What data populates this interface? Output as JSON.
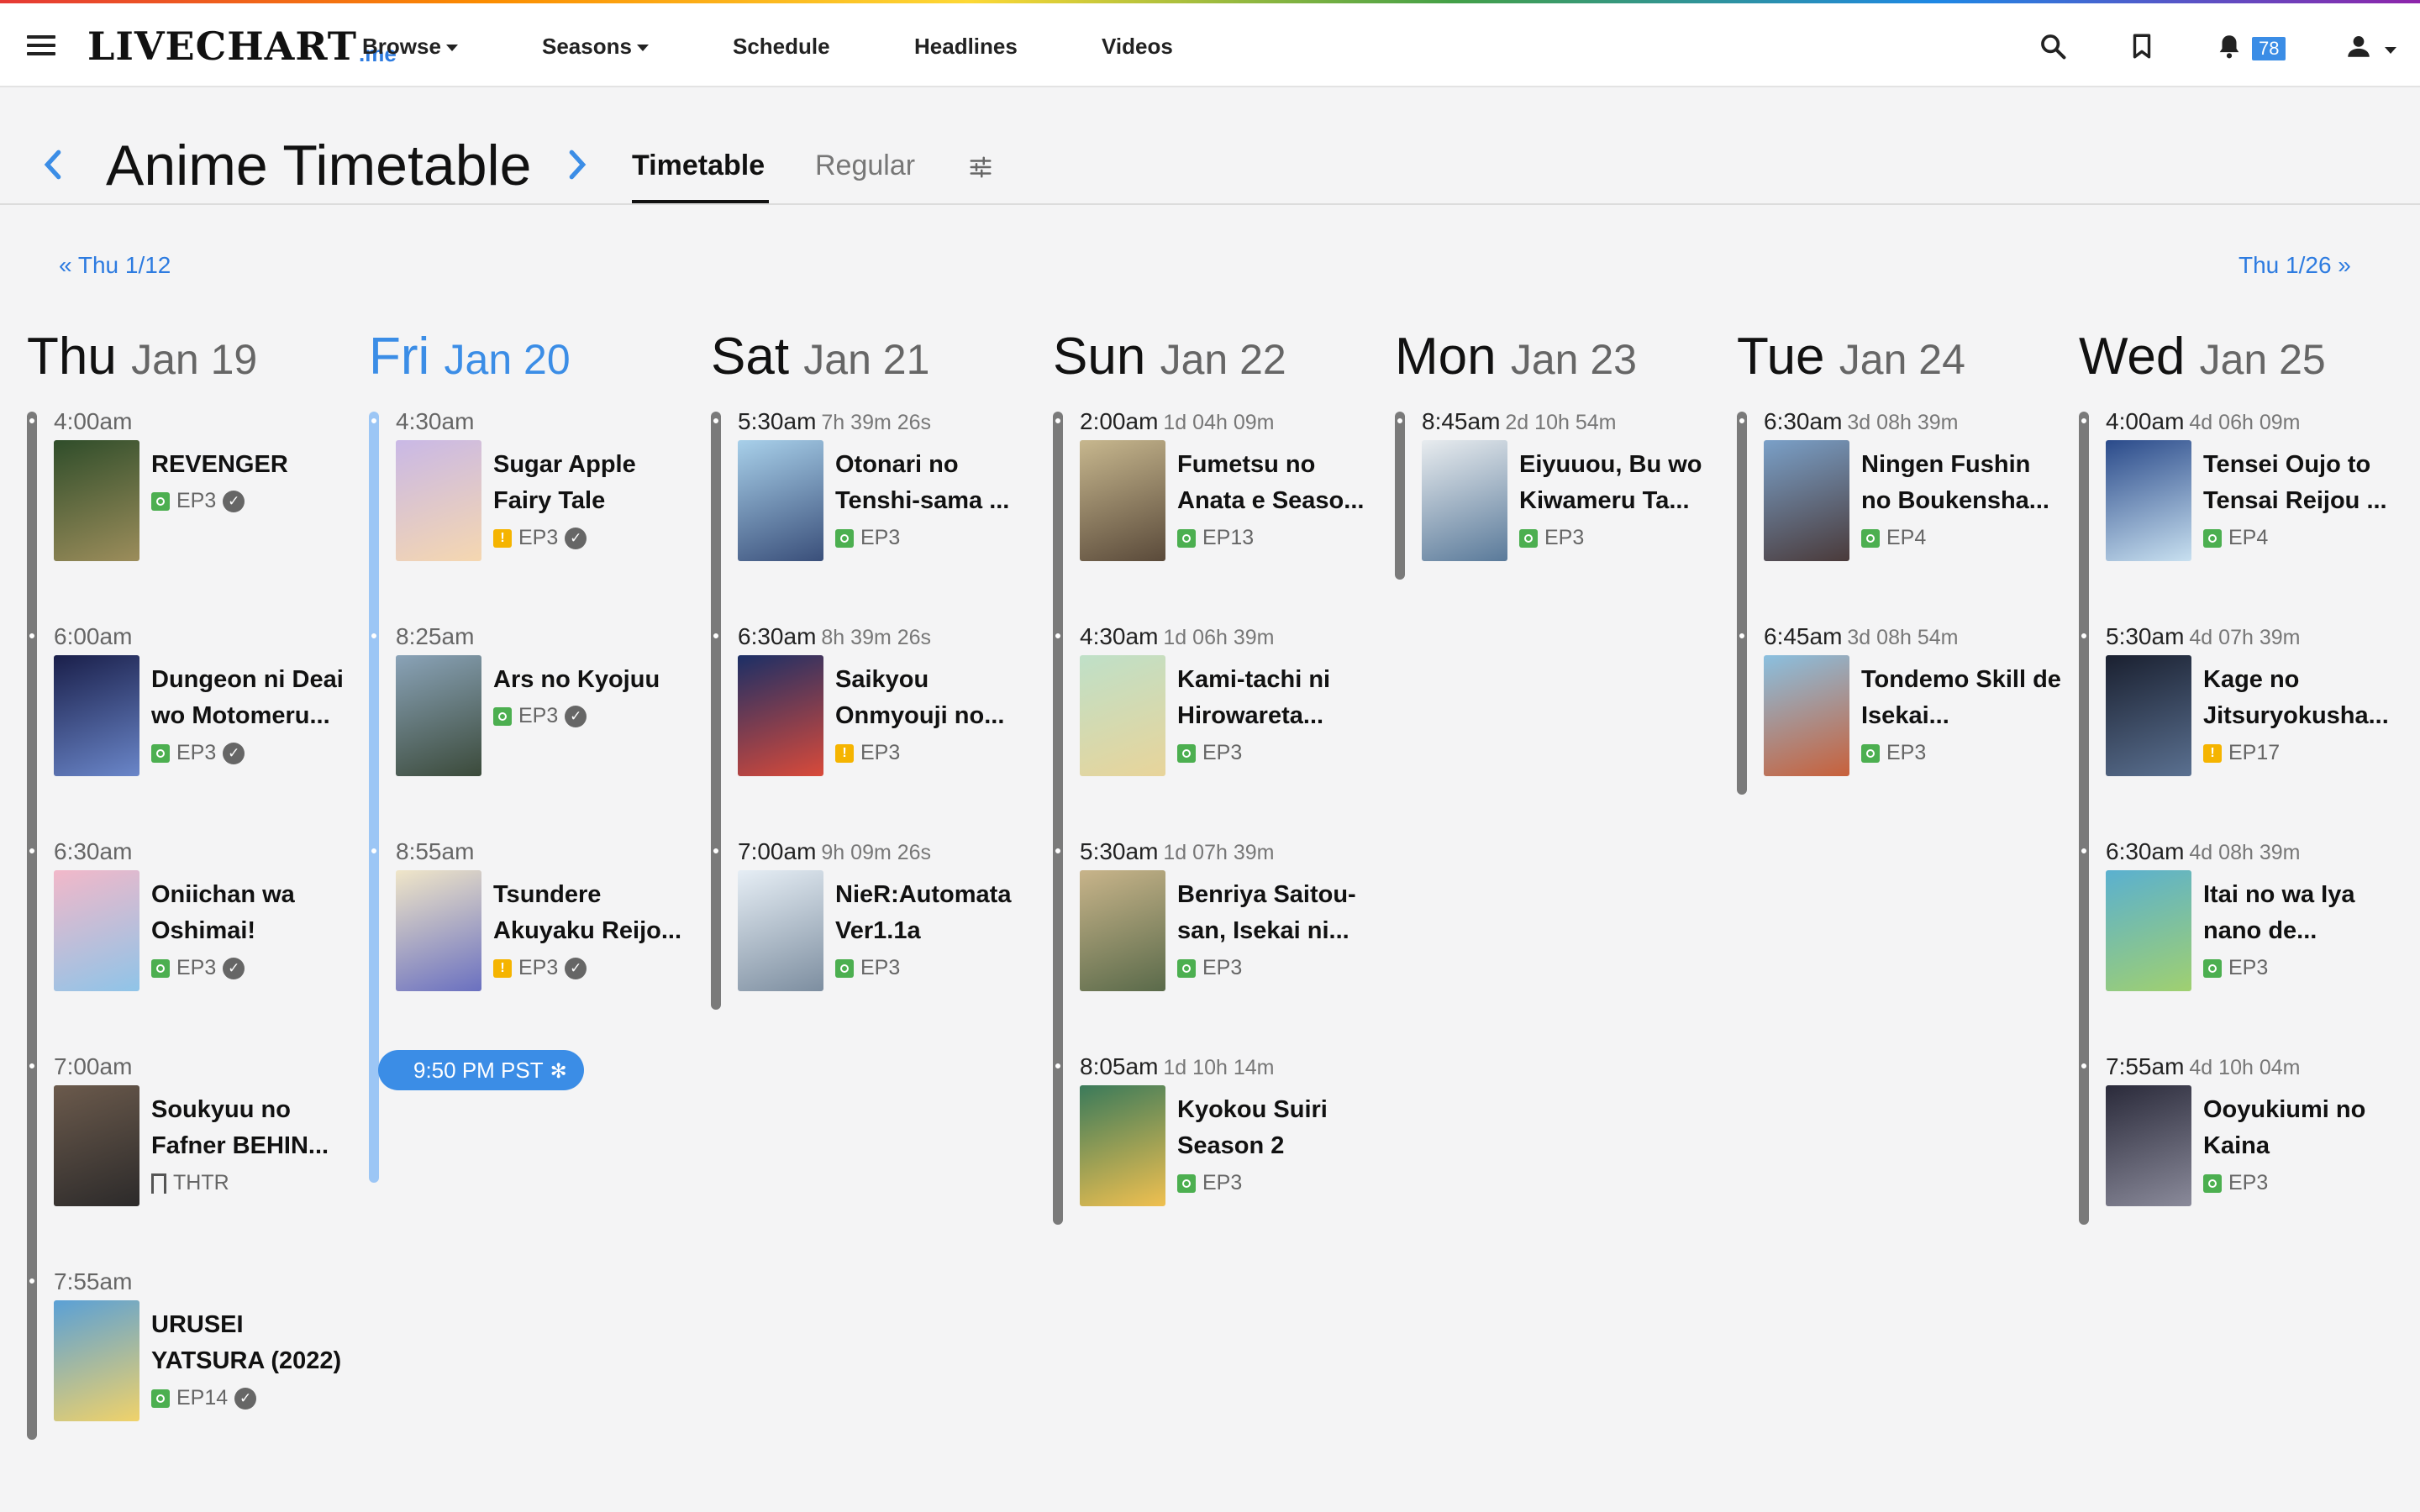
{
  "app": {
    "logo_main": "LIVECHART",
    "logo_suffix": ".me",
    "nav": [
      {
        "label": "Browse",
        "has_caret": true
      },
      {
        "label": "Seasons",
        "has_caret": true
      },
      {
        "label": "Schedule",
        "has_caret": false
      },
      {
        "label": "Headlines",
        "has_caret": false
      },
      {
        "label": "Videos",
        "has_caret": false
      }
    ],
    "notification_count": "78",
    "icons": [
      "menu-icon",
      "search-icon",
      "bookmark-icon",
      "bell-icon",
      "user-icon"
    ]
  },
  "header": {
    "title": "Anime Timetable",
    "tabs": [
      {
        "label": "Timetable",
        "active": true
      },
      {
        "label": "Regular",
        "active": false
      }
    ]
  },
  "week_nav": {
    "prev": "« Thu 1/12",
    "next": "Thu 1/26 »"
  },
  "current_time": "9:50 PM PST",
  "days": [
    {
      "name": "Thu",
      "date": "Jan 19",
      "today": false,
      "entries": [
        {
          "time": "4:00am",
          "countdown": "",
          "title": "REVENGER",
          "status": "watching",
          "episode": "EP3",
          "checked": true,
          "poster": [
            "#2f4d2a",
            "#9c8d5b"
          ]
        },
        {
          "time": "6:00am",
          "countdown": "",
          "title": "Dungeon ni Deai wo Motomeru...",
          "status": "watching",
          "episode": "EP3",
          "checked": true,
          "poster": [
            "#1a1f4a",
            "#6a86c9"
          ]
        },
        {
          "time": "6:30am",
          "countdown": "",
          "title": "Oniichan wa Oshimai!",
          "status": "watching",
          "episode": "EP3",
          "checked": true,
          "poster": [
            "#f2b8c9",
            "#8fc4e8"
          ]
        },
        {
          "time": "7:00am",
          "countdown": "",
          "title": "Soukyuu no Fafner BEHIN...",
          "status": "planned",
          "episode": "THTR",
          "checked": false,
          "poster": [
            "#6b5a4c",
            "#2c2a2a"
          ]
        },
        {
          "time": "7:55am",
          "countdown": "",
          "title": "URUSEI YATSURA (2022)",
          "status": "watching",
          "episode": "EP14",
          "checked": true,
          "poster": [
            "#5aa0d6",
            "#f0d26a"
          ]
        }
      ]
    },
    {
      "name": "Fri",
      "date": "Jan 20",
      "today": true,
      "entries": [
        {
          "time": "4:30am",
          "countdown": "",
          "title": "Sugar Apple Fairy Tale",
          "status": "paused",
          "episode": "EP3",
          "checked": true,
          "poster": [
            "#c9b8e6",
            "#f5d7b0"
          ]
        },
        {
          "time": "8:25am",
          "countdown": "",
          "title": "Ars no Kyojuu",
          "status": "watching",
          "episode": "EP3",
          "checked": true,
          "poster": [
            "#8aa3b8",
            "#3b4a3a"
          ]
        },
        {
          "time": "8:55am",
          "countdown": "",
          "title": "Tsundere Akuyaku Reijo...",
          "status": "paused",
          "episode": "EP3",
          "checked": true,
          "poster": [
            "#f0e6c8",
            "#6a70c0"
          ]
        }
      ]
    },
    {
      "name": "Sat",
      "date": "Jan 21",
      "today": false,
      "entries": [
        {
          "time": "5:30am",
          "countdown": "7h 39m 26s",
          "title": "Otonari no Tenshi-sama ...",
          "status": "watching",
          "episode": "EP3",
          "checked": false,
          "poster": [
            "#a8d0ea",
            "#3a4f7a"
          ]
        },
        {
          "time": "6:30am",
          "countdown": "8h 39m 26s",
          "title": "Saikyou Onmyouji no...",
          "status": "paused",
          "episode": "EP3",
          "checked": false,
          "poster": [
            "#1b2f66",
            "#d94a3a"
          ]
        },
        {
          "time": "7:00am",
          "countdown": "9h 09m 26s",
          "title": "NieR:Automata Ver1.1a",
          "status": "watching",
          "episode": "EP3",
          "checked": false,
          "poster": [
            "#e6eef5",
            "#7d8ea0"
          ]
        }
      ]
    },
    {
      "name": "Sun",
      "date": "Jan 22",
      "today": false,
      "entries": [
        {
          "time": "2:00am",
          "countdown": "1d 04h 09m",
          "title": "Fumetsu no Anata e Seaso...",
          "status": "watching",
          "episode": "EP13",
          "checked": false,
          "poster": [
            "#c7b78e",
            "#5a4a3a"
          ]
        },
        {
          "time": "4:30am",
          "countdown": "1d 06h 39m",
          "title": "Kami-tachi ni Hirowareta...",
          "status": "watching",
          "episode": "EP3",
          "checked": false,
          "poster": [
            "#bfe0c8",
            "#e8d49a"
          ]
        },
        {
          "time": "5:30am",
          "countdown": "1d 07h 39m",
          "title": "Benriya Saitou-san, Isekai ni...",
          "status": "watching",
          "episode": "EP3",
          "checked": false,
          "poster": [
            "#c8b48a",
            "#5a6a4a"
          ]
        },
        {
          "time": "8:05am",
          "countdown": "1d 10h 14m",
          "title": "Kyokou Suiri Season 2",
          "status": "watching",
          "episode": "EP3",
          "checked": false,
          "poster": [
            "#3a7a5a",
            "#f0c050"
          ]
        }
      ]
    },
    {
      "name": "Mon",
      "date": "Jan 23",
      "today": false,
      "entries": [
        {
          "time": "8:45am",
          "countdown": "2d 10h 54m",
          "title": "Eiyuuou, Bu wo Kiwameru Ta...",
          "status": "watching",
          "episode": "EP3",
          "checked": false,
          "poster": [
            "#e8ecef",
            "#5a7a9a"
          ]
        }
      ]
    },
    {
      "name": "Tue",
      "date": "Jan 24",
      "today": false,
      "entries": [
        {
          "time": "6:30am",
          "countdown": "3d 08h 39m",
          "title": "Ningen Fushin no Boukensha...",
          "status": "watching",
          "episode": "EP4",
          "checked": false,
          "poster": [
            "#7aa0c8",
            "#4a3a3a"
          ]
        },
        {
          "time": "6:45am",
          "countdown": "3d 08h 54m",
          "title": "Tondemo Skill de Isekai...",
          "status": "watching",
          "episode": "EP3",
          "checked": false,
          "poster": [
            "#8ac0e0",
            "#c8603a"
          ]
        }
      ]
    },
    {
      "name": "Wed",
      "date": "Jan 25",
      "today": false,
      "entries": [
        {
          "time": "4:00am",
          "countdown": "4d 06h 09m",
          "title": "Tensei Oujo to Tensai Reijou ...",
          "status": "watching",
          "episode": "EP4",
          "checked": false,
          "poster": [
            "#2a4a8a",
            "#c8e0f0"
          ]
        },
        {
          "time": "5:30am",
          "countdown": "4d 07h 39m",
          "title": "Kage no Jitsuryokusha...",
          "status": "paused",
          "episode": "EP17",
          "checked": false,
          "poster": [
            "#1a2030",
            "#5a7090"
          ]
        },
        {
          "time": "6:30am",
          "countdown": "4d 08h 39m",
          "title": "Itai no wa Iya nano de...",
          "status": "watching",
          "episode": "EP3",
          "checked": false,
          "poster": [
            "#5ab0d0",
            "#a0d070"
          ]
        },
        {
          "time": "7:55am",
          "countdown": "4d 10h 04m",
          "title": "Ooyukiumi no Kaina",
          "status": "watching",
          "episode": "EP3",
          "checked": false,
          "poster": [
            "#2a2a3a",
            "#8a8a9a"
          ]
        }
      ]
    }
  ]
}
